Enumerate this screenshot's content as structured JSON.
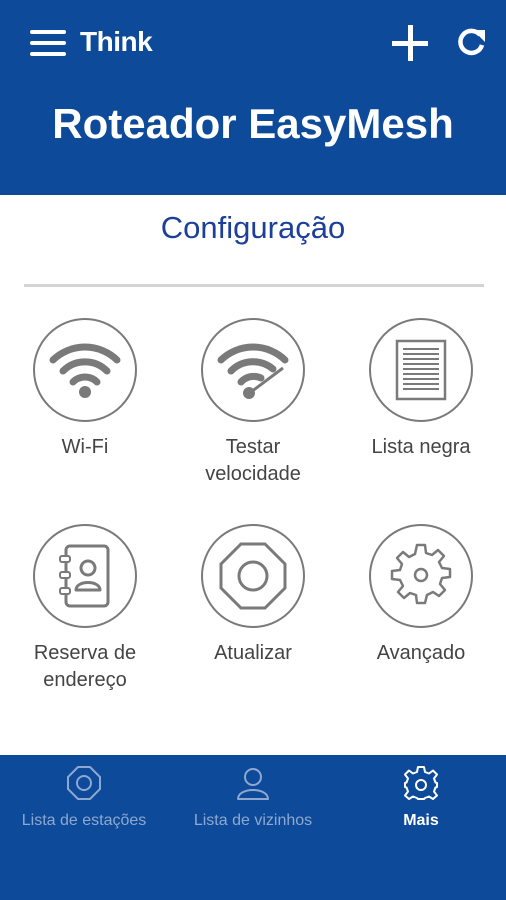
{
  "header": {
    "brand": "Think",
    "title": "Roteador EasyMesh",
    "icons": {
      "menu": "hamburger-menu-icon",
      "add": "plus-icon",
      "refresh": "refresh-icon"
    }
  },
  "main": {
    "section_title": "Configuração",
    "tiles": [
      {
        "label": "Wi-Fi",
        "icon": "wifi-icon"
      },
      {
        "label": "Testar\nvelocidade",
        "icon": "speedtest-icon"
      },
      {
        "label": "Lista negra",
        "icon": "document-list-icon"
      },
      {
        "label": "Reserva de\nendereço",
        "icon": "address-book-icon"
      },
      {
        "label": "Atualizar",
        "icon": "octagon-nut-icon"
      },
      {
        "label": "Avançado",
        "icon": "gear-icon"
      }
    ]
  },
  "bottom_nav": {
    "items": [
      {
        "label": "Lista de estações",
        "icon": "router-icon",
        "active": false
      },
      {
        "label": "Lista de vizinhos",
        "icon": "user-icon",
        "active": false
      },
      {
        "label": "Mais",
        "icon": "gear-icon",
        "active": true
      }
    ]
  },
  "colors": {
    "primary": "#0d4a9a",
    "section_title": "#1c3f9a",
    "icon_gray": "#7a7a7a",
    "nav_inactive": "#8ea8cf"
  }
}
